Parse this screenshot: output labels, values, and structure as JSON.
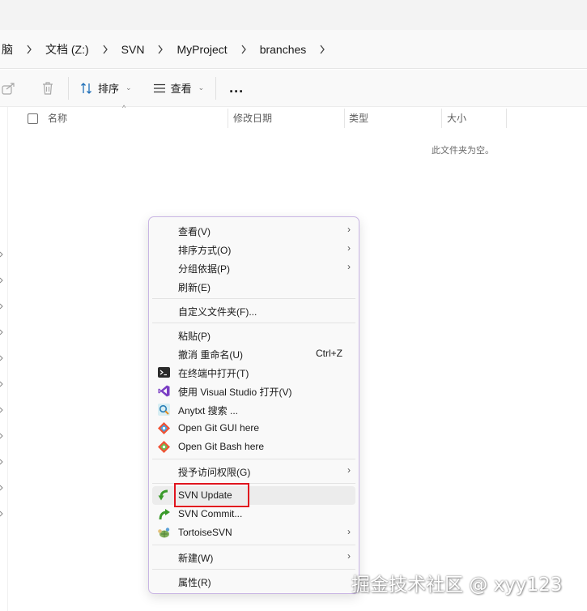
{
  "breadcrumb": [
    "脑",
    "文档 (Z:)",
    "SVN",
    "MyProject",
    "branches"
  ],
  "toolbar": {
    "share_icon": "share-icon",
    "delete_icon": "trash-icon",
    "sort_label": "排序",
    "view_label": "查看",
    "more_label": "..."
  },
  "columns": {
    "name": "名称",
    "modified": "修改日期",
    "type": "类型",
    "size": "大小"
  },
  "empty_message": "此文件夹为空。",
  "context_menu": {
    "view": "查看(V)",
    "sort_by": "排序方式(O)",
    "group_by": "分组依据(P)",
    "refresh": "刷新(E)",
    "customize_folder": "自定义文件夹(F)...",
    "paste": "粘贴(P)",
    "undo_rename": "撤消 重命名(U)",
    "undo_shortcut": "Ctrl+Z",
    "open_in_terminal": "在终端中打开(T)",
    "open_with_vs": "使用 Visual Studio 打开(V)",
    "anytxt_search": "Anytxt 搜索 ...",
    "git_gui": "Open Git GUI here",
    "git_bash": "Open Git Bash here",
    "grant_access": "授予访问权限(G)",
    "svn_update": "SVN Update",
    "svn_commit": "SVN Commit...",
    "tortoise_svn": "TortoiseSVN",
    "new": "新建(W)",
    "properties": "属性(R)"
  },
  "colors": {
    "highlight_box": "#e0141e",
    "menu_border": "#c9b6e4",
    "vs_purple": "#7b3fc4",
    "git_orange": "#f05133"
  },
  "watermark": "掘金技术社区 @ xyy123"
}
